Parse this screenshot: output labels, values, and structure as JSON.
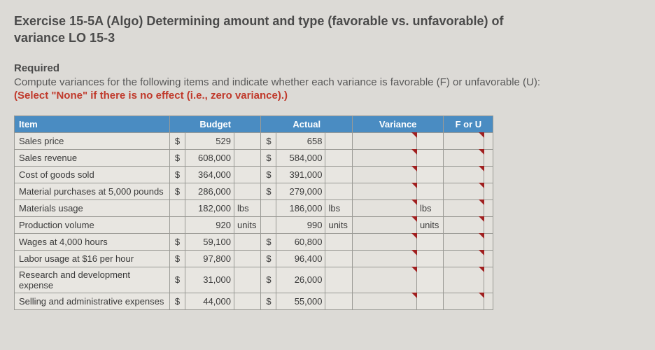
{
  "title_line1": "Exercise 15-5A (Algo) Determining amount and type (favorable vs. unfavorable) of",
  "title_line2": "variance LO 15-3",
  "required_label": "Required",
  "required_text": "Compute variances for the following items and indicate whether each variance is favorable (F) or unfavorable (U):",
  "red_note": "(Select \"None\" if there is no effect (i.e., zero variance).)",
  "headers": {
    "item": "Item",
    "budget": "Budget",
    "actual": "Actual",
    "variance": "Variance",
    "foru": "F or U"
  },
  "rows": [
    {
      "item": "Sales price",
      "bcur": "$",
      "bnum": "529",
      "bunit": "",
      "acur": "$",
      "anum": "658",
      "aunit": "",
      "vunit": ""
    },
    {
      "item": "Sales revenue",
      "bcur": "$",
      "bnum": "608,000",
      "bunit": "",
      "acur": "$",
      "anum": "584,000",
      "aunit": "",
      "vunit": ""
    },
    {
      "item": "Cost of goods sold",
      "bcur": "$",
      "bnum": "364,000",
      "bunit": "",
      "acur": "$",
      "anum": "391,000",
      "aunit": "",
      "vunit": ""
    },
    {
      "item": "Material purchases at 5,000 pounds",
      "bcur": "$",
      "bnum": "286,000",
      "bunit": "",
      "acur": "$",
      "anum": "279,000",
      "aunit": "",
      "vunit": ""
    },
    {
      "item": "Materials usage",
      "bcur": "",
      "bnum": "182,000",
      "bunit": "lbs",
      "acur": "",
      "anum": "186,000",
      "aunit": "lbs",
      "vunit": "lbs"
    },
    {
      "item": "Production volume",
      "bcur": "",
      "bnum": "920",
      "bunit": "units",
      "acur": "",
      "anum": "990",
      "aunit": "units",
      "vunit": "units"
    },
    {
      "item": "Wages at 4,000 hours",
      "bcur": "$",
      "bnum": "59,100",
      "bunit": "",
      "acur": "$",
      "anum": "60,800",
      "aunit": "",
      "vunit": ""
    },
    {
      "item": "Labor usage at $16 per hour",
      "bcur": "$",
      "bnum": "97,800",
      "bunit": "",
      "acur": "$",
      "anum": "96,400",
      "aunit": "",
      "vunit": ""
    },
    {
      "item": "Research and development expense",
      "bcur": "$",
      "bnum": "31,000",
      "bunit": "",
      "acur": "$",
      "anum": "26,000",
      "aunit": "",
      "vunit": ""
    },
    {
      "item": "Selling and administrative expenses",
      "bcur": "$",
      "bnum": "44,000",
      "bunit": "",
      "acur": "$",
      "anum": "55,000",
      "aunit": "",
      "vunit": ""
    }
  ]
}
